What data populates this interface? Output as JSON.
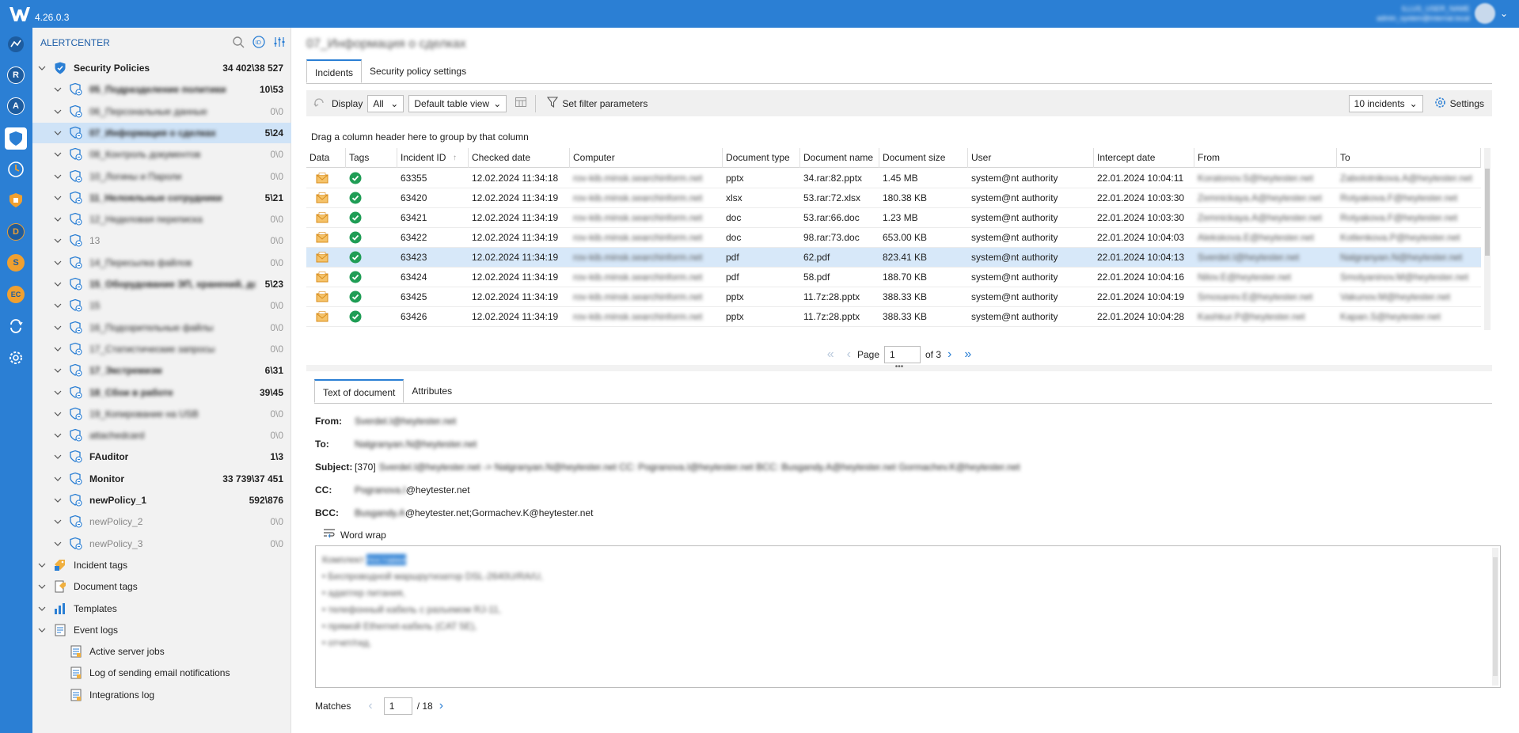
{
  "app": {
    "version": "4.26.0.3",
    "user_line1": "ILLUS_USER_NAME",
    "user_line2": "admin_system@internal.local"
  },
  "tree": {
    "header": "ALERTCENTER",
    "rows": [
      {
        "label": "Security Policies",
        "count": "34 402\\38 527",
        "level": 0,
        "bold": true,
        "blur": false
      },
      {
        "label": "05_Подразделение политики",
        "count": "10\\53",
        "level": 1,
        "bold": true,
        "blur": true
      },
      {
        "label": "06_Персональные данные",
        "count": "0\\0",
        "level": 1,
        "bold": false,
        "blur": true
      },
      {
        "label": "07_Информация о сделках",
        "count": "5\\24",
        "level": 1,
        "bold": true,
        "blur": true,
        "selected": true
      },
      {
        "label": "08_Контроль документов",
        "count": "0\\0",
        "level": 1,
        "bold": false,
        "blur": true
      },
      {
        "label": "10_Логины и Пароли",
        "count": "0\\0",
        "level": 1,
        "bold": false,
        "blur": true
      },
      {
        "label": "11_Нелояльные сотрудники",
        "count": "5\\21",
        "level": 1,
        "bold": true,
        "blur": true
      },
      {
        "label": "12_Неделовая переписка",
        "count": "0\\0",
        "level": 1,
        "bold": false,
        "blur": true
      },
      {
        "label": "13",
        "count": "0\\0",
        "level": 1,
        "bold": false,
        "blur": false
      },
      {
        "label": "14_Пересылка файлов",
        "count": "0\\0",
        "level": 1,
        "bold": false,
        "blur": true
      },
      {
        "label": "15_Оборудование ЭП, хранений, доступ...",
        "count": "5\\23",
        "level": 1,
        "bold": true,
        "blur": true
      },
      {
        "label": "15",
        "count": "0\\0",
        "level": 1,
        "bold": false,
        "blur": true
      },
      {
        "label": "16_Подозрительные файлы",
        "count": "0\\0",
        "level": 1,
        "bold": false,
        "blur": true
      },
      {
        "label": "17_Статистические запросы",
        "count": "0\\0",
        "level": 1,
        "bold": false,
        "blur": true
      },
      {
        "label": "17_Экстремизм",
        "count": "6\\31",
        "level": 1,
        "bold": true,
        "blur": true
      },
      {
        "label": "18_Сбои в работе",
        "count": "39\\45",
        "level": 1,
        "bold": true,
        "blur": true
      },
      {
        "label": "19_Копирование на USB",
        "count": "0\\0",
        "level": 1,
        "bold": false,
        "blur": true
      },
      {
        "label": "attachedcard",
        "count": "0\\0",
        "level": 1,
        "bold": false,
        "blur": true
      },
      {
        "label": "FAuditor",
        "count": "1\\3",
        "level": 1,
        "bold": true,
        "blur": false
      },
      {
        "label": "Monitor",
        "count": "33 739\\37 451",
        "level": 1,
        "bold": true,
        "blur": false
      },
      {
        "label": "newPolicy_1",
        "count": "592\\876",
        "level": 1,
        "bold": true,
        "blur": false
      },
      {
        "label": "newPolicy_2",
        "count": "0\\0",
        "level": 1,
        "bold": false,
        "blur": false
      },
      {
        "label": "newPolicy_3",
        "count": "0\\0",
        "level": 1,
        "bold": false,
        "blur": false
      },
      {
        "label": "Incident tags",
        "count": "",
        "level": 0,
        "bold": false,
        "blur": false
      },
      {
        "label": "Document tags",
        "count": "",
        "level": 0,
        "bold": false,
        "blur": false
      },
      {
        "label": "Templates",
        "count": "",
        "level": 0,
        "bold": false,
        "blur": false
      },
      {
        "label": "Event logs",
        "count": "",
        "level": 0,
        "bold": false,
        "blur": false
      },
      {
        "label": "Active server jobs",
        "count": "",
        "level": 2,
        "bold": false,
        "blur": false
      },
      {
        "label": "Log of sending email notifications",
        "count": "",
        "level": 2,
        "bold": false,
        "blur": false
      },
      {
        "label": "Integrations log",
        "count": "",
        "level": 2,
        "bold": false,
        "blur": false
      }
    ]
  },
  "main": {
    "title": "07_Информация о сделках",
    "tabs": [
      "Incidents",
      "Security policy settings"
    ],
    "toolbar": {
      "display_label": "Display",
      "display_value": "All",
      "view_value": "Default table view",
      "filter_label": "Set filter parameters",
      "incidents_value": "10 incidents",
      "settings_label": "Settings"
    },
    "group_hint": "Drag a column header here to group by that column",
    "columns": [
      "Data",
      "Tags",
      "Incident ID",
      "Checked date",
      "Computer",
      "Document type",
      "Document name",
      "Document size",
      "User",
      "Intercept date",
      "From",
      "To"
    ],
    "rows": [
      [
        "63355",
        "12.02.2024 11:34:18",
        "rov-kib.minsk.searchinform.net",
        "pptx",
        "34.rar:82.pptx",
        "1.45 MB",
        "system@nt authority",
        "22.01.2024 10:04:11",
        "Koratonov.S@heytester.net",
        "Zabolotnikova.A@heytester.net"
      ],
      [
        "63420",
        "12.02.2024 11:34:19",
        "rov-kib.minsk.searchinform.net",
        "xlsx",
        "53.rar:72.xlsx",
        "180.38 KB",
        "system@nt authority",
        "22.01.2024 10:03:30",
        "Zemnickaya.A@heytester.net",
        "Rotyakova.F@heytester.net"
      ],
      [
        "63421",
        "12.02.2024 11:34:19",
        "rov-kib.minsk.searchinform.net",
        "doc",
        "53.rar:66.doc",
        "1.23 MB",
        "system@nt authority",
        "22.01.2024 10:03:30",
        "Zemnickaya.A@heytester.net",
        "Rotyakova.F@heytester.net"
      ],
      [
        "63422",
        "12.02.2024 11:34:19",
        "rov-kib.minsk.searchinform.net",
        "doc",
        "98.rar:73.doc",
        "653.00 KB",
        "system@nt authority",
        "22.01.2024 10:04:03",
        "Alekskova.E@heytester.net",
        "Kotlenkova.P@heytester.net"
      ],
      [
        "63423",
        "12.02.2024 11:34:19",
        "rov-kib.minsk.searchinform.net",
        "pdf",
        "62.pdf",
        "823.41 KB",
        "system@nt authority",
        "22.01.2024 10:04:13",
        "Sverdel.I@heytester.net",
        "Nalgranyan.N@heytester.net"
      ],
      [
        "63424",
        "12.02.2024 11:34:19",
        "rov-kib.minsk.searchinform.net",
        "pdf",
        "58.pdf",
        "188.70 KB",
        "system@nt authority",
        "22.01.2024 10:04:16",
        "Nilov.E@heytester.net",
        "Smolyaninov.M@heytester.net"
      ],
      [
        "63425",
        "12.02.2024 11:34:19",
        "rov-kib.minsk.searchinform.net",
        "pptx",
        "11.7z:28.pptx",
        "388.33 KB",
        "system@nt authority",
        "22.01.2024 10:04:19",
        "Smosarev.E@heytester.net",
        "Vakunov.M@heytester.net"
      ],
      [
        "63426",
        "12.02.2024 11:34:19",
        "rov-kib.minsk.searchinform.net",
        "pptx",
        "11.7z:28.pptx",
        "388.33 KB",
        "system@nt authority",
        "22.01.2024 10:04:28",
        "Kashkur.P@heytester.net",
        "Kapan.S@heytester.net"
      ]
    ],
    "selected_row_index": 4,
    "pager": {
      "page_label": "Page",
      "page_value": "1",
      "of_label": "of 3"
    },
    "bottom_tabs": [
      "Text of document",
      "Attributes"
    ],
    "fields": {
      "from_label": "From:",
      "from_value": "Sverdel.I@heytester.net",
      "to_label": "To:",
      "to_value": "Nalgranyan.N@heytester.net",
      "subject_label": "Subject:",
      "subject_prefix": "[370]",
      "subject_value": "Sverdel.I@heytester.net -> Nalgranyan.N@heytester.net CC: Pogranova.I@heytester.net BCC: Busgandy.A@heytester.net Gormachev.K@heytester.net",
      "cc_label": "CC:",
      "cc_blur": "Pogranova.I",
      "cc_value": "@heytester.net",
      "bcc_label": "BCC:",
      "bcc_blur": "Busgandy.A",
      "bcc_value": "@heytester.net;Gormachev.K@heytester.net"
    },
    "word_wrap_label": "Word wrap",
    "document_lines": [
      "Комплект поставки",
      "• Беспроводной маршрутизатор DSL-2640U/RA/U,",
      "• адаптер питания,",
      "• телефонный кабель с разъемом RJ-11,",
      "• прямой Ethernet-кабель (CAT 5E),",
      "• отчет/гид."
    ],
    "matches": {
      "label": "Matches",
      "value": "1",
      "total": "/ 18"
    }
  }
}
